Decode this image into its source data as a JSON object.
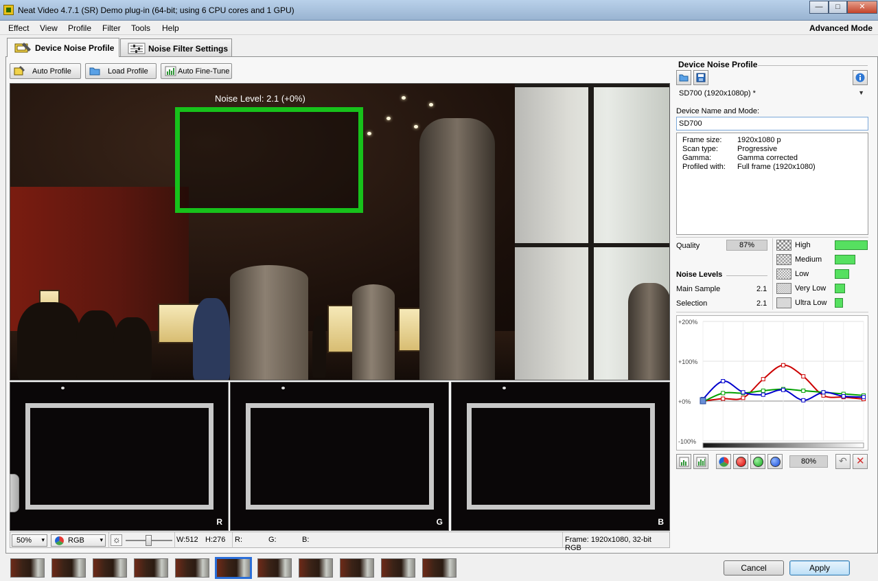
{
  "window": {
    "title": "Neat Video 4.7.1 (SR) Demo plug-in (64-bit; using 6 CPU cores and 1 GPU)",
    "controls": [
      "minimize-icon",
      "maximize-icon",
      "close-icon"
    ]
  },
  "menu": {
    "items": [
      "Effect",
      "View",
      "Profile",
      "Filter",
      "Tools",
      "Help"
    ],
    "mode": "Advanced Mode"
  },
  "tabs": [
    {
      "label": "Device Noise Profile",
      "active": true
    },
    {
      "label": "Noise Filter Settings",
      "active": false
    }
  ],
  "toolbar": {
    "auto_profile": "Auto Profile",
    "load_profile": "Load Profile",
    "auto_fine_tune": "Auto Fine-Tune"
  },
  "viewer": {
    "noise_label": "Noise Level: 2.1 (+0%)",
    "channels": [
      "R",
      "G",
      "B"
    ],
    "zoom": "50%",
    "color_mode": "RGB",
    "width": "W:512",
    "height": "H:276",
    "r_label": "R:",
    "g_label": "G:",
    "b_label": "B:",
    "frame_info": "Frame: 1920x1080, 32-bit RGB"
  },
  "filmstrip": {
    "count": 11,
    "selected": 5
  },
  "dialog": {
    "cancel": "Cancel",
    "apply": "Apply"
  },
  "profile_panel": {
    "title": "Device Noise Profile",
    "profile_name": "SD700 (1920x1080p) *",
    "device_label": "Device Name and Mode:",
    "device_value": "SD700",
    "info": [
      {
        "k": "Frame size:",
        "v": "1920x1080 p"
      },
      {
        "k": "Scan type:",
        "v": "Progressive"
      },
      {
        "k": "Gamma:",
        "v": "Gamma corrected"
      },
      {
        "k": "Profiled with:",
        "v": "Full frame (1920x1080)"
      }
    ],
    "quality_label": "Quality",
    "quality_value": "87%",
    "noise_levels_title": "Noise Levels",
    "main_sample_label": "Main Sample",
    "main_sample_value": "2.1",
    "selection_label": "Selection",
    "selection_value": "2.1",
    "levels": [
      {
        "name": "High",
        "fraction": 1.0
      },
      {
        "name": "Medium",
        "fraction": 0.62
      },
      {
        "name": "Low",
        "fraction": 0.44
      },
      {
        "name": "Very Low",
        "fraction": 0.32
      },
      {
        "name": "Ultra Low",
        "fraction": 0.24
      }
    ],
    "sharpness": "80%",
    "accent_color": "#56e060"
  },
  "chart_data": {
    "type": "line",
    "ytick_labels": [
      "+200%",
      "+100%",
      "+0%",
      "-100%"
    ],
    "ylim": [
      -100,
      200
    ],
    "x": [
      0,
      1,
      2,
      3,
      4,
      5,
      6,
      7,
      8
    ],
    "series": [
      {
        "color": "#cc0000",
        "values": [
          0,
          6,
          8,
          55,
          90,
          62,
          14,
          10,
          5
        ]
      },
      {
        "color": "#00a000",
        "values": [
          -2,
          20,
          20,
          26,
          30,
          26,
          22,
          18,
          14
        ]
      },
      {
        "color": "#0000cc",
        "values": [
          5,
          50,
          22,
          16,
          28,
          2,
          22,
          12,
          10
        ]
      }
    ]
  }
}
